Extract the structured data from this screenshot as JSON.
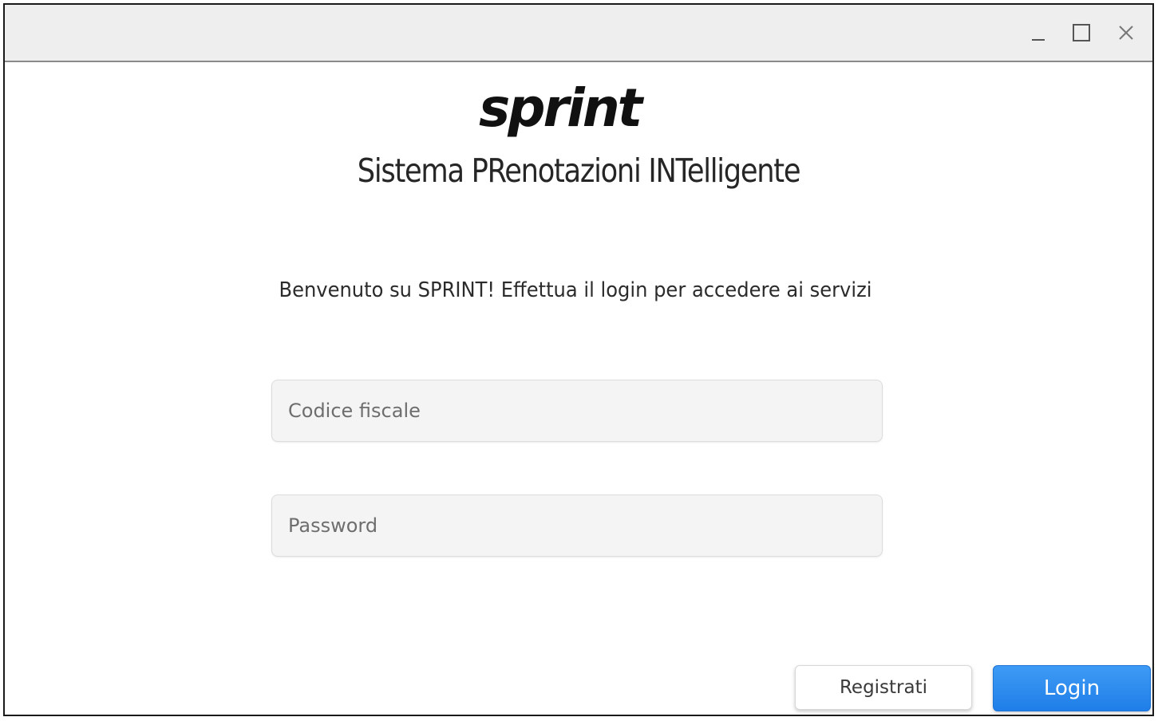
{
  "window": {
    "controls": {
      "minimize_icon": "minimize-icon",
      "maximize_icon": "maximize-icon",
      "close_icon": "close-icon"
    }
  },
  "header": {
    "logo_text": "sprint",
    "title": "Sistema PRenotazioni INTelligente"
  },
  "main": {
    "welcome": "Benvenuto su SPRINT! Effettua il login per accedere ai servizi",
    "fields": {
      "codice_fiscale": {
        "placeholder": "Codice fiscale",
        "value": ""
      },
      "password": {
        "placeholder": "Password",
        "value": ""
      }
    }
  },
  "actions": {
    "register_label": "Registrati",
    "login_label": "Login"
  },
  "colors": {
    "accent": "#2a8cef",
    "title_bar": "#eeeeee",
    "field_bg": "#f4f4f4"
  }
}
